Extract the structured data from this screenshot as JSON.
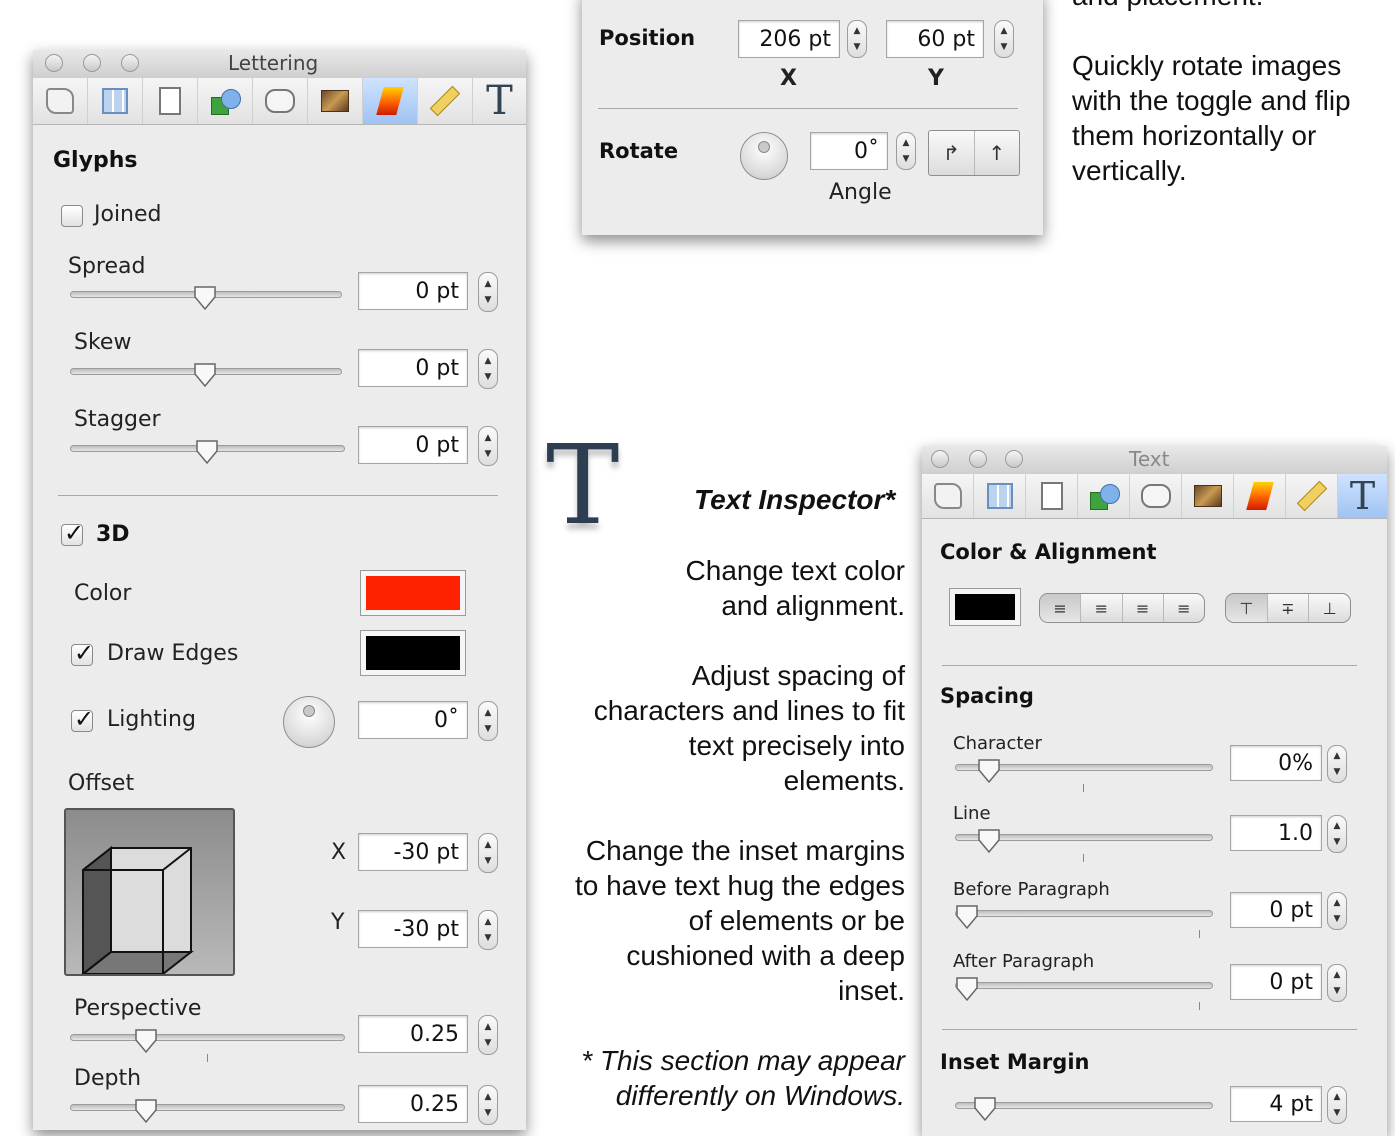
{
  "lettering_panel": {
    "title": "Lettering",
    "glyphs_header": "Glyphs",
    "joined_label": "Joined",
    "joined_checked": false,
    "spread_label": "Spread",
    "spread_value": "0 pt",
    "skew_label": "Skew",
    "skew_value": "0 pt",
    "stagger_label": "Stagger",
    "stagger_value": "0 pt",
    "threed_label": "3D",
    "threed_checked": true,
    "color_label": "Color",
    "color_value": "#ff2200",
    "draw_edges_label": "Draw Edges",
    "draw_edges_checked": true,
    "edge_color": "#000000",
    "lighting_label": "Lighting",
    "lighting_checked": true,
    "lighting_angle": "0˚",
    "offset_label": "Offset",
    "offset_x_label": "X",
    "offset_x_value": "-30 pt",
    "offset_y_label": "Y",
    "offset_y_value": "-30 pt",
    "perspective_label": "Perspective",
    "perspective_value": "0.25",
    "depth_label": "Depth",
    "depth_value": "0.25"
  },
  "metrics_panel": {
    "position_label": "Position",
    "x_value": "206 pt",
    "y_value": "60 pt",
    "x_label": "X",
    "y_label": "Y",
    "rotate_label": "Rotate",
    "angle_value": "0˚",
    "angle_label": "Angle"
  },
  "text_panel": {
    "title": "Text",
    "color_alignment_header": "Color & Alignment",
    "text_color": "#000000",
    "spacing_header": "Spacing",
    "character_label": "Character",
    "character_value": "0%",
    "line_label": "Line",
    "line_value": "1.0",
    "before_paragraph_label": "Before Paragraph",
    "before_paragraph_value": "0 pt",
    "after_paragraph_label": "After Paragraph",
    "after_paragraph_value": "0 pt",
    "inset_margin_header": "Inset Margin",
    "inset_margin_value": "4 pt"
  },
  "descriptions": {
    "top_right_fragment": "and placement.",
    "rotate_line1": "Quickly rotate images",
    "rotate_line2": "with the toggle and flip",
    "rotate_line3": "them horizontally or",
    "rotate_line4": "vertically.",
    "text_inspector_title": "Text Inspector*",
    "p1_line1": "Change text color",
    "p1_line2": "and alignment.",
    "p2_line1": "Adjust spacing of",
    "p2_line2": "characters and lines to fit",
    "p2_line3": "text precisely into",
    "p2_line4": "elements.",
    "p3_line1": "Change the inset margins",
    "p3_line2": "to have text hug the edges",
    "p3_line3": "of elements or be",
    "p3_line4": "cushioned with a deep",
    "p3_line5": "inset.",
    "footnote_line1": "* This section may appear",
    "footnote_line2": "differently on Windows.",
    "big_t_glyph": "T"
  }
}
